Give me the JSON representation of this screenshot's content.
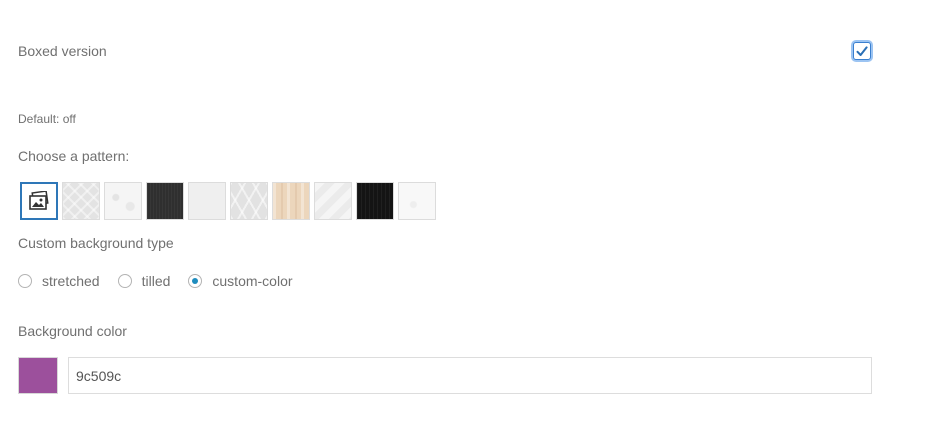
{
  "boxed": {
    "label": "Boxed version",
    "checked": true,
    "default_text": "Default: off"
  },
  "pattern": {
    "label": "Choose a pattern:",
    "items": [
      {
        "name": "upload-image",
        "bg": "#ffffff"
      },
      {
        "name": "light-gray-geometric",
        "bg": "#e3e3e3"
      },
      {
        "name": "white-marble",
        "bg": "#f5f5f5"
      },
      {
        "name": "dark-charcoal",
        "bg": "#2f2f2f"
      },
      {
        "name": "plain-light",
        "bg": "#efefef"
      },
      {
        "name": "gray-ornament",
        "bg": "#e2e2e2"
      },
      {
        "name": "light-wood",
        "bg": "#ecd6bc"
      },
      {
        "name": "light-gray-soft",
        "bg": "#ebebeb"
      },
      {
        "name": "black-wood",
        "bg": "#141414"
      },
      {
        "name": "white-floral",
        "bg": "#f8f8f8"
      }
    ]
  },
  "background_type": {
    "label": "Custom background type",
    "options": [
      "stretched",
      "tilled",
      "custom-color"
    ],
    "selected": "custom-color"
  },
  "background_color": {
    "label": "Background color",
    "swatch": "#9c509c",
    "value": "9c509c"
  }
}
